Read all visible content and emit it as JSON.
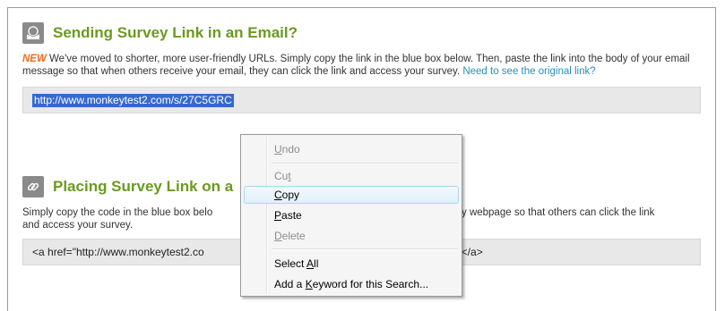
{
  "email_section": {
    "title": "Sending Survey Link in an Email?",
    "new_tag": "NEW",
    "body": " We've moved to shorter, more user-friendly URLs. Simply copy the link in the blue box below. Then, paste the link into the body of your email message so that when others receive your email, they can click the link and access your survey. ",
    "see_original_link": "Need to see the original link?",
    "survey_url": "http://www.monkeytest2.com/s/27C5GRC"
  },
  "web_section": {
    "title": "Placing Survey Link on a",
    "body_start": "Simply copy the code in the blue box belo",
    "body_end": "y webpage so that others can click the link",
    "body_line2": "and access your survey.",
    "code_start": "<a href=\"http://www.monkeytest2.co",
    "code_end": "ey</a>"
  },
  "context_menu": {
    "items": [
      {
        "label": "Undo",
        "accel": "U",
        "enabled": false
      },
      {
        "label": "Cut",
        "accel": "t",
        "enabled": false
      },
      {
        "label": "Copy",
        "accel": "C",
        "enabled": true,
        "highlighted": true
      },
      {
        "label": "Paste",
        "accel": "P",
        "enabled": true
      },
      {
        "label": "Delete",
        "accel": "D",
        "enabled": false
      },
      {
        "label": "Select All",
        "accel": "A",
        "enabled": true
      },
      {
        "label": "Add a Keyword for this Search...",
        "accel": "K",
        "enabled": true
      }
    ]
  },
  "icons": {
    "email": "envelope-icon",
    "link": "chain-link-icon"
  },
  "colors": {
    "title_green": "#6a9a1f",
    "new_orange": "#ef6c1a",
    "link_blue": "#2b8cb5",
    "selection_blue": "#3569ce"
  }
}
